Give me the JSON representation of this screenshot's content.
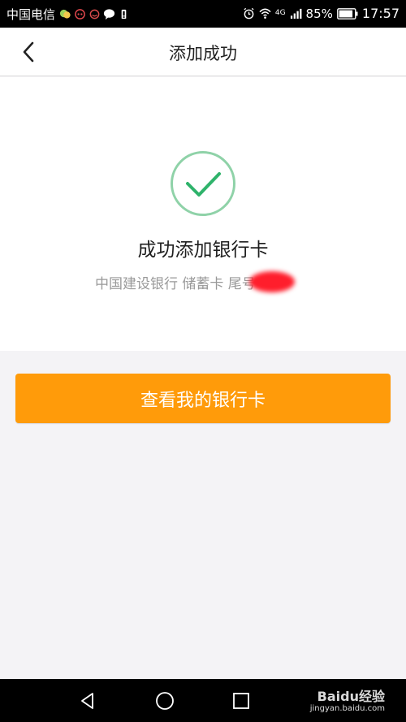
{
  "status_bar": {
    "carrier": "中国电信",
    "network": "4G",
    "battery": "85%",
    "time": "17:57",
    "icons": [
      "wechat-icon",
      "weibo-icon",
      "message-icon",
      "battery-saver-icon",
      "alarm-icon",
      "wifi-icon",
      "signal-icon",
      "battery-icon"
    ]
  },
  "nav": {
    "back_icon": "chevron-left-icon",
    "title": "添加成功"
  },
  "result": {
    "icon": "checkmark-circle-icon",
    "title": "成功添加银行卡",
    "card_info": "中国建设银行 储蓄卡 尾号"
  },
  "actions": {
    "view_cards_label": "查看我的银行卡"
  },
  "system_nav": {
    "buttons": [
      "back-triangle-icon",
      "home-circle-icon",
      "recent-square-icon"
    ]
  },
  "watermark": {
    "brand": "Baidu经验",
    "url": "jingyan.baidu.com"
  },
  "colors": {
    "accent": "#ff9b0a",
    "success": "#2fb36b",
    "success_ring": "#8fd2a8",
    "redaction": "#ff1e2c",
    "page_background": "#f4f3f6"
  }
}
